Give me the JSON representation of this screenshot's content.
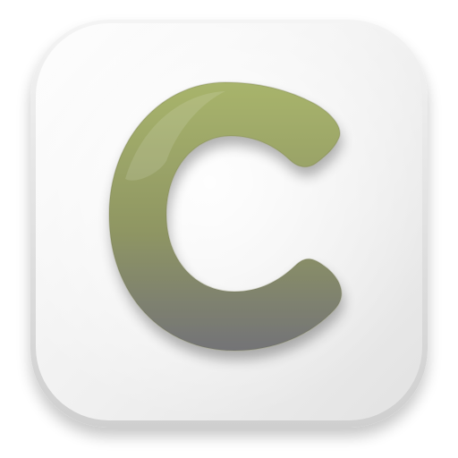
{
  "icon": {
    "semantic": "app-icon-letter-c",
    "tile_color": "#f2f2f2",
    "tile_edge_color": "#dadada",
    "letter_top_color": "#a4b06a",
    "letter_bottom_color": "#76767a"
  }
}
